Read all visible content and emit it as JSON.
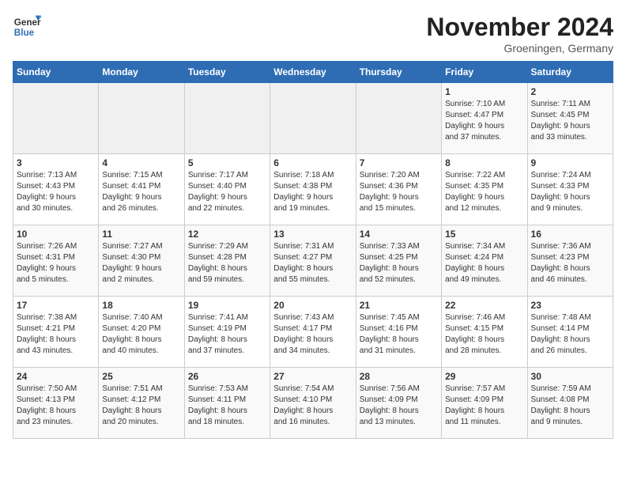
{
  "header": {
    "logo_line1": "General",
    "logo_line2": "Blue",
    "month": "November 2024",
    "location": "Groeningen, Germany"
  },
  "weekdays": [
    "Sunday",
    "Monday",
    "Tuesday",
    "Wednesday",
    "Thursday",
    "Friday",
    "Saturday"
  ],
  "weeks": [
    [
      {
        "day": "",
        "info": ""
      },
      {
        "day": "",
        "info": ""
      },
      {
        "day": "",
        "info": ""
      },
      {
        "day": "",
        "info": ""
      },
      {
        "day": "",
        "info": ""
      },
      {
        "day": "1",
        "info": "Sunrise: 7:10 AM\nSunset: 4:47 PM\nDaylight: 9 hours\nand 37 minutes."
      },
      {
        "day": "2",
        "info": "Sunrise: 7:11 AM\nSunset: 4:45 PM\nDaylight: 9 hours\nand 33 minutes."
      }
    ],
    [
      {
        "day": "3",
        "info": "Sunrise: 7:13 AM\nSunset: 4:43 PM\nDaylight: 9 hours\nand 30 minutes."
      },
      {
        "day": "4",
        "info": "Sunrise: 7:15 AM\nSunset: 4:41 PM\nDaylight: 9 hours\nand 26 minutes."
      },
      {
        "day": "5",
        "info": "Sunrise: 7:17 AM\nSunset: 4:40 PM\nDaylight: 9 hours\nand 22 minutes."
      },
      {
        "day": "6",
        "info": "Sunrise: 7:18 AM\nSunset: 4:38 PM\nDaylight: 9 hours\nand 19 minutes."
      },
      {
        "day": "7",
        "info": "Sunrise: 7:20 AM\nSunset: 4:36 PM\nDaylight: 9 hours\nand 15 minutes."
      },
      {
        "day": "8",
        "info": "Sunrise: 7:22 AM\nSunset: 4:35 PM\nDaylight: 9 hours\nand 12 minutes."
      },
      {
        "day": "9",
        "info": "Sunrise: 7:24 AM\nSunset: 4:33 PM\nDaylight: 9 hours\nand 9 minutes."
      }
    ],
    [
      {
        "day": "10",
        "info": "Sunrise: 7:26 AM\nSunset: 4:31 PM\nDaylight: 9 hours\nand 5 minutes."
      },
      {
        "day": "11",
        "info": "Sunrise: 7:27 AM\nSunset: 4:30 PM\nDaylight: 9 hours\nand 2 minutes."
      },
      {
        "day": "12",
        "info": "Sunrise: 7:29 AM\nSunset: 4:28 PM\nDaylight: 8 hours\nand 59 minutes."
      },
      {
        "day": "13",
        "info": "Sunrise: 7:31 AM\nSunset: 4:27 PM\nDaylight: 8 hours\nand 55 minutes."
      },
      {
        "day": "14",
        "info": "Sunrise: 7:33 AM\nSunset: 4:25 PM\nDaylight: 8 hours\nand 52 minutes."
      },
      {
        "day": "15",
        "info": "Sunrise: 7:34 AM\nSunset: 4:24 PM\nDaylight: 8 hours\nand 49 minutes."
      },
      {
        "day": "16",
        "info": "Sunrise: 7:36 AM\nSunset: 4:23 PM\nDaylight: 8 hours\nand 46 minutes."
      }
    ],
    [
      {
        "day": "17",
        "info": "Sunrise: 7:38 AM\nSunset: 4:21 PM\nDaylight: 8 hours\nand 43 minutes."
      },
      {
        "day": "18",
        "info": "Sunrise: 7:40 AM\nSunset: 4:20 PM\nDaylight: 8 hours\nand 40 minutes."
      },
      {
        "day": "19",
        "info": "Sunrise: 7:41 AM\nSunset: 4:19 PM\nDaylight: 8 hours\nand 37 minutes."
      },
      {
        "day": "20",
        "info": "Sunrise: 7:43 AM\nSunset: 4:17 PM\nDaylight: 8 hours\nand 34 minutes."
      },
      {
        "day": "21",
        "info": "Sunrise: 7:45 AM\nSunset: 4:16 PM\nDaylight: 8 hours\nand 31 minutes."
      },
      {
        "day": "22",
        "info": "Sunrise: 7:46 AM\nSunset: 4:15 PM\nDaylight: 8 hours\nand 28 minutes."
      },
      {
        "day": "23",
        "info": "Sunrise: 7:48 AM\nSunset: 4:14 PM\nDaylight: 8 hours\nand 26 minutes."
      }
    ],
    [
      {
        "day": "24",
        "info": "Sunrise: 7:50 AM\nSunset: 4:13 PM\nDaylight: 8 hours\nand 23 minutes."
      },
      {
        "day": "25",
        "info": "Sunrise: 7:51 AM\nSunset: 4:12 PM\nDaylight: 8 hours\nand 20 minutes."
      },
      {
        "day": "26",
        "info": "Sunrise: 7:53 AM\nSunset: 4:11 PM\nDaylight: 8 hours\nand 18 minutes."
      },
      {
        "day": "27",
        "info": "Sunrise: 7:54 AM\nSunset: 4:10 PM\nDaylight: 8 hours\nand 16 minutes."
      },
      {
        "day": "28",
        "info": "Sunrise: 7:56 AM\nSunset: 4:09 PM\nDaylight: 8 hours\nand 13 minutes."
      },
      {
        "day": "29",
        "info": "Sunrise: 7:57 AM\nSunset: 4:09 PM\nDaylight: 8 hours\nand 11 minutes."
      },
      {
        "day": "30",
        "info": "Sunrise: 7:59 AM\nSunset: 4:08 PM\nDaylight: 8 hours\nand 9 minutes."
      }
    ]
  ]
}
